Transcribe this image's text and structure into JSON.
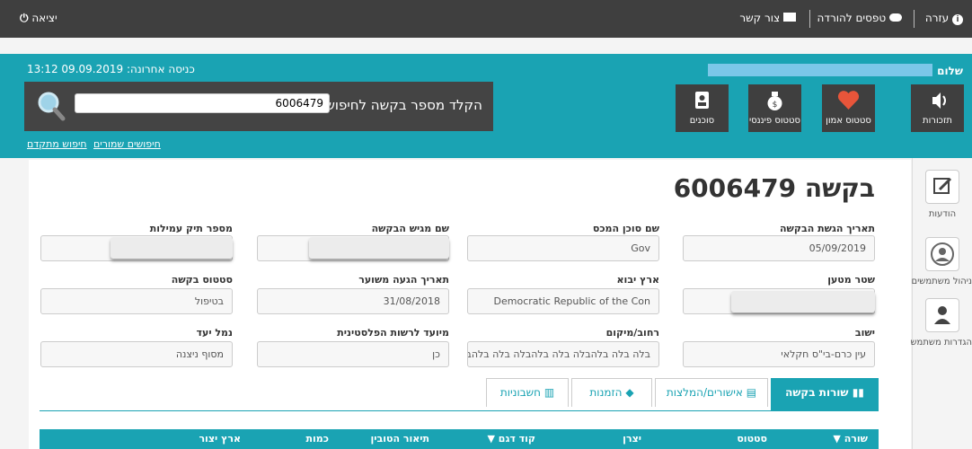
{
  "topbar": {
    "help": "עזרה",
    "download_forms": "טפסים להורדה",
    "contact": "צור קשר",
    "logout": "יציאה"
  },
  "header": {
    "greeting": "שלום",
    "last_login": "כניסה אחרונה: 09.09.2019 13:12",
    "search_label": "הקלד מספר בקשה לחיפוש",
    "search_value": "6006479",
    "saved_searches": "חיפושים שמורים",
    "advanced_search": "חיפוש מתקדם",
    "tiles": [
      {
        "label": "תזכורות",
        "icon": "speaker-icon"
      },
      {
        "label": "סטטוס אמון",
        "icon": "heart-icon"
      },
      {
        "label": "סטטוס פיננסי",
        "icon": "money-bag-icon"
      },
      {
        "label": "סוכנים",
        "icon": "agent-card-icon"
      }
    ]
  },
  "sidenav": {
    "items": [
      {
        "label": "הודעות",
        "icon": "edit-icon"
      },
      {
        "label": "ניהול משתמשים",
        "icon": "user-circle-icon"
      },
      {
        "label": "הגדרות משתמש",
        "icon": "user-icon"
      }
    ]
  },
  "request": {
    "title": "בקשה 6006479",
    "fields": {
      "submit_date": {
        "label": "תאריך הגשת הבקשה",
        "value": "05/09/2019"
      },
      "agent_name": {
        "label": "שם סוכן המכס",
        "value": "Gov"
      },
      "applicant_name": {
        "label": "שם מגיש הבקשה",
        "value": ""
      },
      "commission_file": {
        "label": "מספר תיק עמילות",
        "value": ""
      },
      "bill_of_lading": {
        "label": "שטר מטען",
        "value": ""
      },
      "import_country": {
        "label": "ארץ יבוא",
        "value": "Democratic Republic of the Con"
      },
      "arrival_date": {
        "label": "תאריך הגעה משוער",
        "value": "31/08/2018"
      },
      "request_status": {
        "label": "סטטוס בקשה",
        "value": "בטיפול"
      },
      "settlement": {
        "label": "ישוב",
        "value": "עין כרם-בי\"ס חקלאי"
      },
      "street": {
        "label": "רחוב/מיקום",
        "value": "בלה בלה בלהבלה בלה בלהבלה בלה בלהבלה"
      },
      "palestinian": {
        "label": "מיועד לרשות הפלסטינית",
        "value": "כן"
      },
      "destination_port": {
        "label": "נמל יעד",
        "value": "מסוף ניצנה"
      }
    }
  },
  "tabs": [
    {
      "label": "שורות בקשה",
      "icon": "bar-chart-icon",
      "active": true
    },
    {
      "label": "אישורים/המלצות",
      "icon": "document-icon",
      "active": false
    },
    {
      "label": "הזמנות",
      "icon": "tag-icon",
      "active": false
    },
    {
      "label": "חשבוניות",
      "icon": "invoice-icon",
      "active": false
    }
  ],
  "table": {
    "columns": [
      "שורה",
      "סטטוס",
      "יצרן",
      "קוד דגם",
      "תיאור הטובין",
      "כמות",
      "ארץ יצור"
    ]
  },
  "colors": {
    "accent": "#1aa3b3",
    "dark": "#3f3f3f",
    "heart": "#e8553a"
  }
}
